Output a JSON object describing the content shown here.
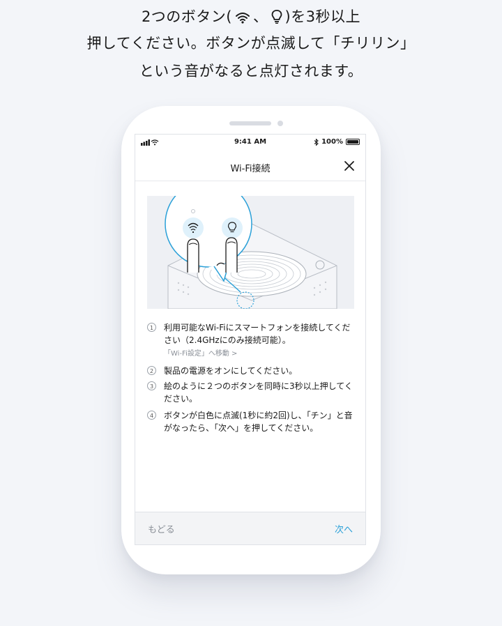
{
  "headline": {
    "line1_pre": "2つのボタン(",
    "line1_sep": "、",
    "line1_post": ")を3秒以上",
    "line2": "押してください。ボタンが点滅して「チリリン」",
    "line3": "という音がなると点灯されます。"
  },
  "status_bar": {
    "time": "9:41 AM",
    "battery": "100%"
  },
  "nav": {
    "title": "Wi-Fi接続"
  },
  "steps": [
    {
      "num": "1",
      "text": "利用可能なWi-Fiにスマートフォンを接続してください（2.4GHzにのみ接続可能）。",
      "link": "「Wi-Fi設定」へ移動 >"
    },
    {
      "num": "2",
      "text": "製品の電源をオンにしてください。"
    },
    {
      "num": "3",
      "text": "絵のように２つのボタンを同時に3秒以上押してください。"
    },
    {
      "num": "4",
      "text": "ボタンが白色に点滅(1秒に約2回)し、「チン」と音がなったら、「次へ」を押してください。"
    }
  ],
  "footer": {
    "back_label": "もどる",
    "next_label": "次へ"
  },
  "colors": {
    "accent": "#2aa0d8",
    "background": "#f3f5f9",
    "muted": "#8a8f97"
  },
  "icons": {
    "wifi": "wifi-icon",
    "bulb": "bulb-icon",
    "close": "close-icon"
  }
}
